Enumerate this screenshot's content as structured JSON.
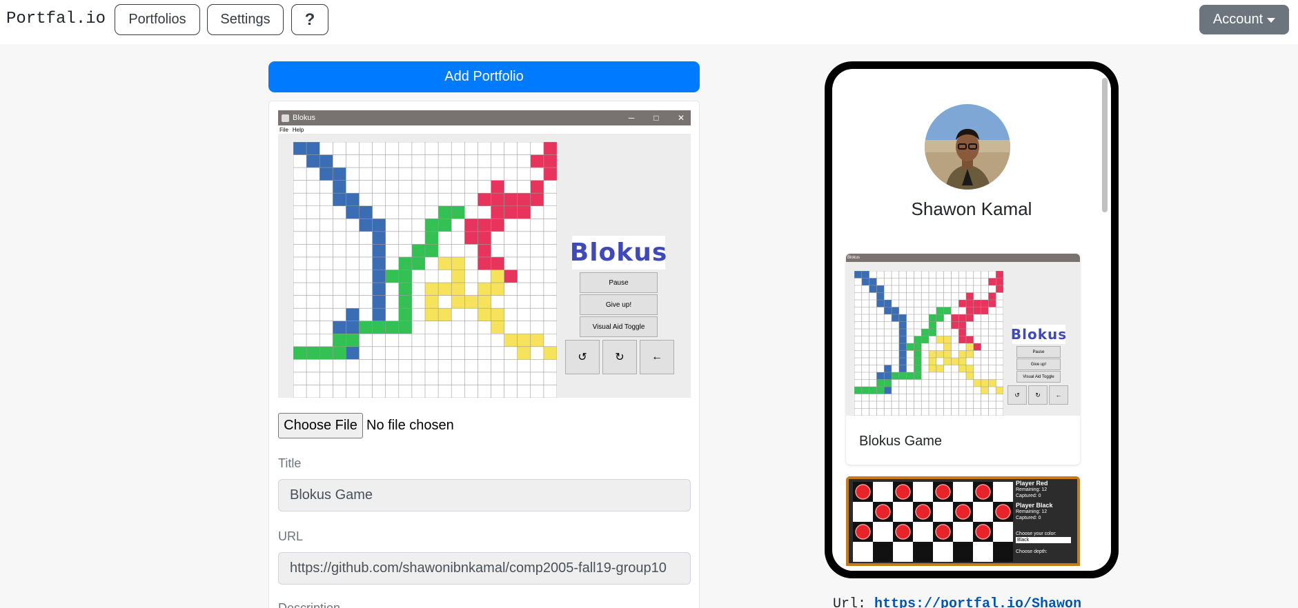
{
  "navbar": {
    "brand": "Portfal.io",
    "portfolios_label": "Portfolios",
    "settings_label": "Settings",
    "help_label": "?",
    "account_label": "Account"
  },
  "editor": {
    "add_portfolio_label": "Add Portfolio",
    "file_button_label": "Choose File",
    "file_status": "No file chosen",
    "title_label": "Title",
    "title_value": "Blokus Game",
    "url_label": "URL",
    "url_value": "https://github.com/shawonibnkamal/comp2005-fall19-group10",
    "description_label": "Description"
  },
  "blokus_screenshot": {
    "window_title": "Blokus",
    "menu_items": [
      "File",
      "Help"
    ],
    "logo_text": "Blokus",
    "buttons": [
      "Pause",
      "Give up!",
      "Visual Aid Toggle"
    ],
    "arrow_buttons": [
      "↺",
      "↻",
      "←"
    ],
    "colors": {
      "blue": "#3a6db3",
      "red": "#e8345d",
      "green": "#33c153",
      "yellow": "#f7e25b"
    }
  },
  "phone_preview": {
    "profile_name": "Shawon Kamal",
    "cards": [
      {
        "title": "Blokus Game"
      }
    ],
    "checkers_panel": {
      "player_red": "Player Red",
      "red_stats": [
        "Remaining: 12",
        "Captured: 0"
      ],
      "player_black": "Player Black",
      "black_stats": [
        "Remaining: 12",
        "Captured: 0"
      ],
      "choose_color": "Choose your color:",
      "color_value": "Black",
      "choose_depth": "Choose depth:"
    }
  },
  "share": {
    "url_label": "Url: ",
    "url_value": "https://portfal.io/Shawon"
  }
}
